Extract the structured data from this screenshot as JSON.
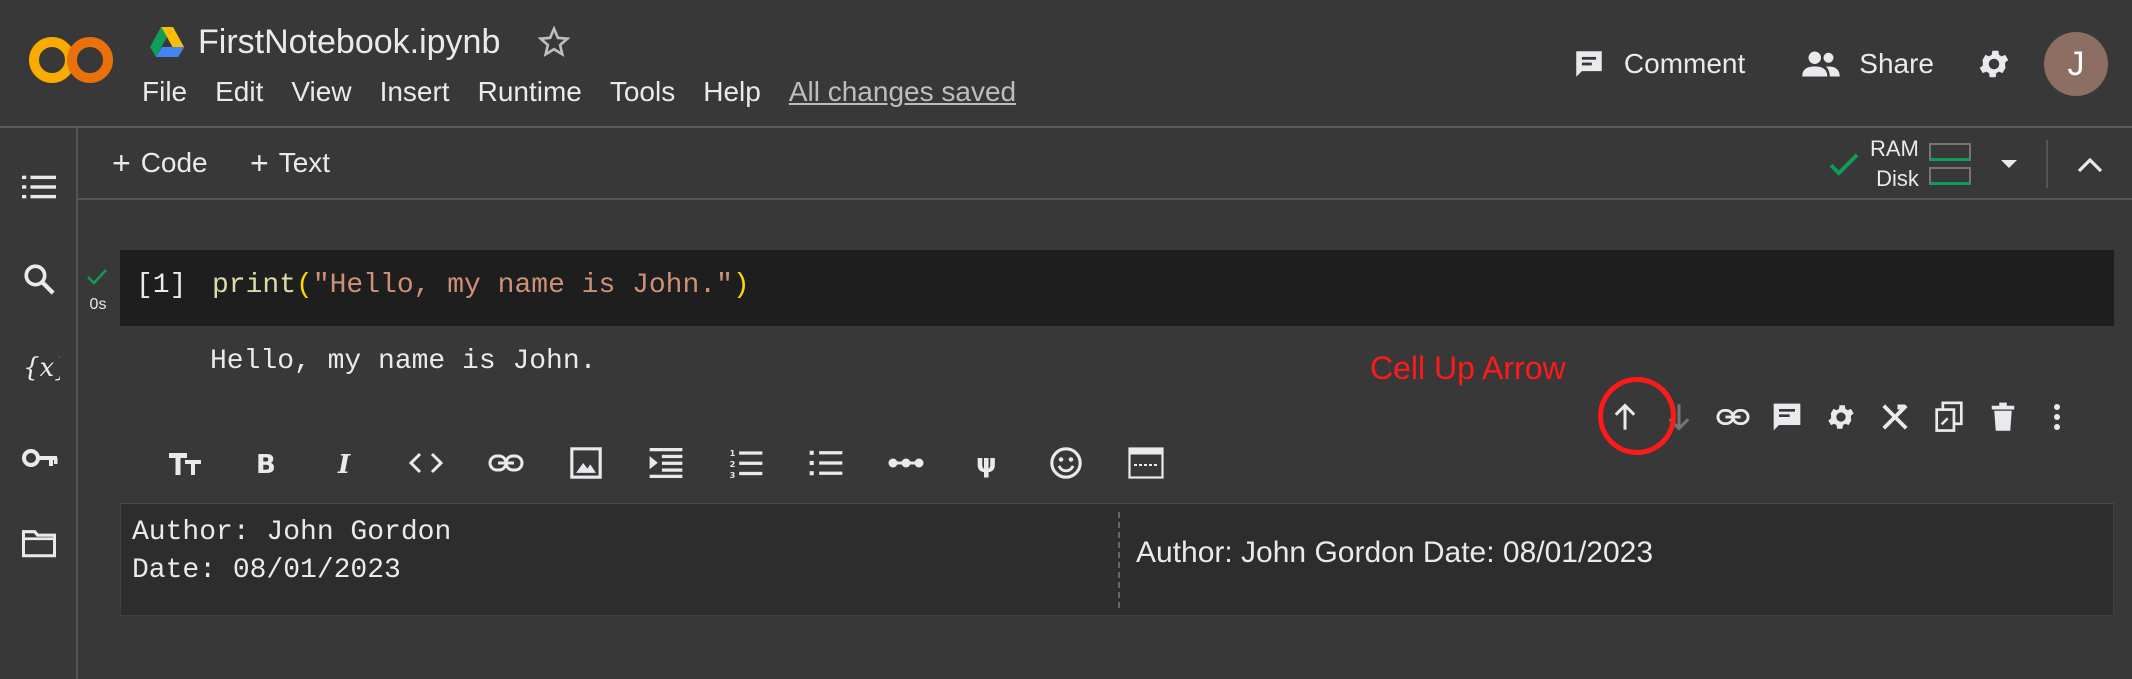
{
  "header": {
    "logo_text": "CO",
    "doc_title": "FirstNotebook.ipynb",
    "menu": [
      "File",
      "Edit",
      "View",
      "Insert",
      "Runtime",
      "Tools",
      "Help"
    ],
    "save_status": "All changes saved",
    "comment_label": "Comment",
    "share_label": "Share",
    "avatar_initial": "J"
  },
  "toolbar": {
    "add_code_label": "Code",
    "add_text_label": "Text",
    "ram_label": "RAM",
    "disk_label": "Disk"
  },
  "code_cell": {
    "exec_count": "[1]",
    "run_time": "0s",
    "code_fn": "print",
    "code_open": "(",
    "code_string": "\"Hello, my name is John.\"",
    "code_close": ")",
    "output": "Hello, my name is John."
  },
  "annotation": {
    "label": "Cell Up Arrow"
  },
  "text_cell": {
    "source_line1": "Author: John Gordon",
    "source_line2": "Date: 08/01/2023",
    "preview": "Author: John Gordon Date: 08/01/2023"
  },
  "colors": {
    "background": "#383838",
    "code_bg": "#1e1e1e",
    "accent_orange": "#f9ab00",
    "annotation_red": "#ff1a1a",
    "success_green": "#0f9d58"
  }
}
